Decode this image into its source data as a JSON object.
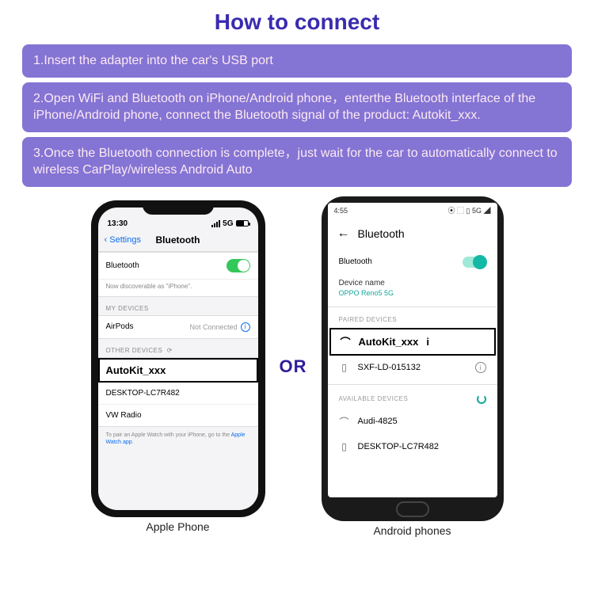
{
  "title": "How to connect",
  "steps": {
    "s1": "1.Insert the adapter into the car's USB port",
    "s2": "2.Open WiFi and Bluetooth on iPhone/Android phone，enterthe Bluetooth interface of the iPhone/Android phone, connect the Bluetooth signal of the product: Autokit_xxx.",
    "s3": "3.Once the Bluetooth connection is complete，just wait for the car to automatically connect to wireless CarPlay/wireless Android Auto"
  },
  "or_label": "OR",
  "iphone": {
    "caption": "Apple Phone",
    "time": "13:30",
    "signal_label": "5G",
    "back_label": "Settings",
    "nav_title": "Bluetooth",
    "bt_row": "Bluetooth",
    "discoverable": "Now discoverable as \"iPhone\".",
    "my_devices_hdr": "MY DEVICES",
    "airpods": "AirPods",
    "not_connected": "Not Connected",
    "other_devices_hdr": "OTHER DEVICES",
    "autokit": "AutoKit_xxx",
    "desktop": "DESKTOP-LC7R482",
    "vwradio": "VW Radio",
    "pair_note_a": "To pair an Apple Watch with your iPhone, go to the ",
    "pair_note_b": "Apple Watch app"
  },
  "android": {
    "caption": "Android phones",
    "time": "4:55",
    "status_icons": "⦿ ⬚ ▯ 5G ◢",
    "nav_title": "Bluetooth",
    "bt_row": "Bluetooth",
    "device_name_label": "Device name",
    "device_name_value": "OPPO Reno5 5G",
    "paired_hdr": "PAIRED DEVICES",
    "autokit": "AutoKit_xxx",
    "sxf": "SXF-LD-015132",
    "avail_hdr": "AVAILABLE DEVICES",
    "audi": "Audi-4825",
    "desktop": "DESKTOP-LC7R482"
  }
}
